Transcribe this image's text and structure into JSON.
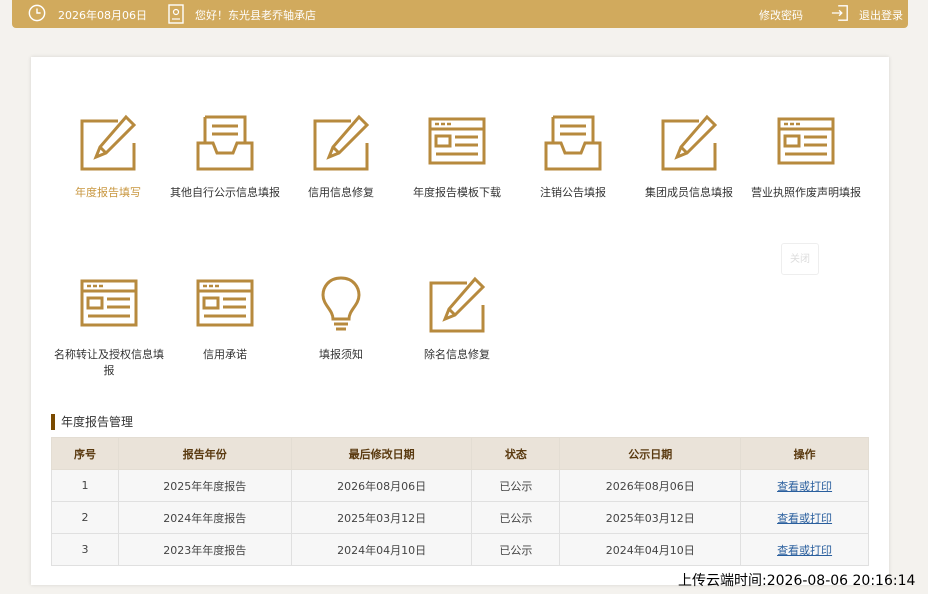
{
  "topbar": {
    "date": "2026年08月06日",
    "greeting": "您好！东光县老乔轴承店",
    "change_password": "修改密码",
    "logout": "退出登录"
  },
  "tiles": [
    {
      "label": "年度报告填写",
      "icon": "pencil-form-icon",
      "active": true
    },
    {
      "label": "其他自行公示信息填报",
      "icon": "inbox-tray-icon"
    },
    {
      "label": "信用信息修复",
      "icon": "pencil-form-icon"
    },
    {
      "label": "年度报告模板下载",
      "icon": "browser-window-icon"
    },
    {
      "label": "注销公告填报",
      "icon": "inbox-tray-icon"
    },
    {
      "label": "集团成员信息填报",
      "icon": "pencil-form-icon"
    },
    {
      "label": "营业执照作废声明填报",
      "icon": "browser-window-icon"
    },
    {
      "label": "名称转让及授权信息填报",
      "icon": "browser-window-icon"
    },
    {
      "label": "信用承诺",
      "icon": "browser-window-icon"
    },
    {
      "label": "填报须知",
      "icon": "lightbulb-icon"
    },
    {
      "label": "除名信息修复",
      "icon": "pencil-form-icon"
    }
  ],
  "close_label": "关闭",
  "section_title": "年度报告管理",
  "table": {
    "headers": [
      "序号",
      "报告年份",
      "最后修改日期",
      "状态",
      "公示日期",
      "操作"
    ],
    "rows": [
      [
        "1",
        "2025年年度报告",
        "2026年08月06日",
        "已公示",
        "2026年08月06日",
        "查看或打印"
      ],
      [
        "2",
        "2024年年度报告",
        "2025年03月12日",
        "已公示",
        "2025年03月12日",
        "查看或打印"
      ],
      [
        "3",
        "2023年年度报告",
        "2024年04月10日",
        "已公示",
        "2024年04月10日",
        "查看或打印"
      ]
    ]
  },
  "upload_time": "上传云端时间:2026-08-06 20:16:14",
  "colors": {
    "brand": "#d1aa5d",
    "icon": "#b78a3e",
    "active_label": "#c8963e",
    "link": "#2a5f9e"
  }
}
